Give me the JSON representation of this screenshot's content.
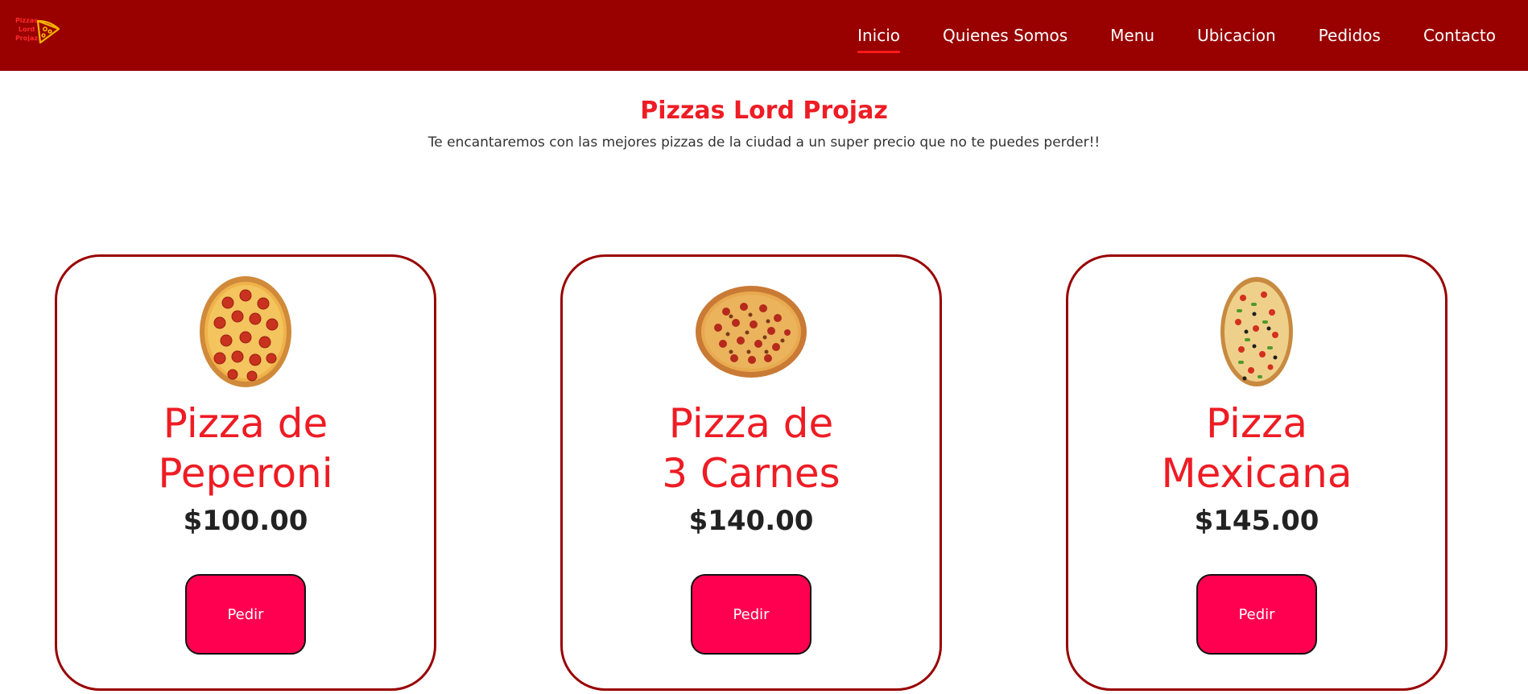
{
  "nav": {
    "logo_text": "Pizzas\nLord\nProjaz",
    "logo_icon": "pizza-slice-icon",
    "links": [
      {
        "label": "Inicio",
        "active": true
      },
      {
        "label": "Quienes Somos",
        "active": false
      },
      {
        "label": "Menu",
        "active": false
      },
      {
        "label": "Ubicacion",
        "active": false
      },
      {
        "label": "Pedidos",
        "active": false
      },
      {
        "label": "Contacto",
        "active": false
      }
    ]
  },
  "hero": {
    "title": "Pizzas Lord Projaz",
    "subtitle": "Te encantaremos con las mejores pizzas de la ciudad a un super precio que no te puedes perder!!"
  },
  "products": [
    {
      "name": "Pizza de\nPeperoni",
      "price": "$100.00",
      "button_label": "Pedir",
      "image": "pepperoni-pizza-image"
    },
    {
      "name": "Pizza de\n3 Carnes",
      "price": "$140.00",
      "button_label": "Pedir",
      "image": "three-meats-pizza-image"
    },
    {
      "name": "Pizza\nMexicana",
      "price": "$145.00",
      "button_label": "Pedir",
      "image": "mexican-pizza-image"
    }
  ],
  "colors": {
    "navbar": "#990000",
    "accent_red": "#ee1c24",
    "button": "#ff0050",
    "card_border": "#990000"
  }
}
